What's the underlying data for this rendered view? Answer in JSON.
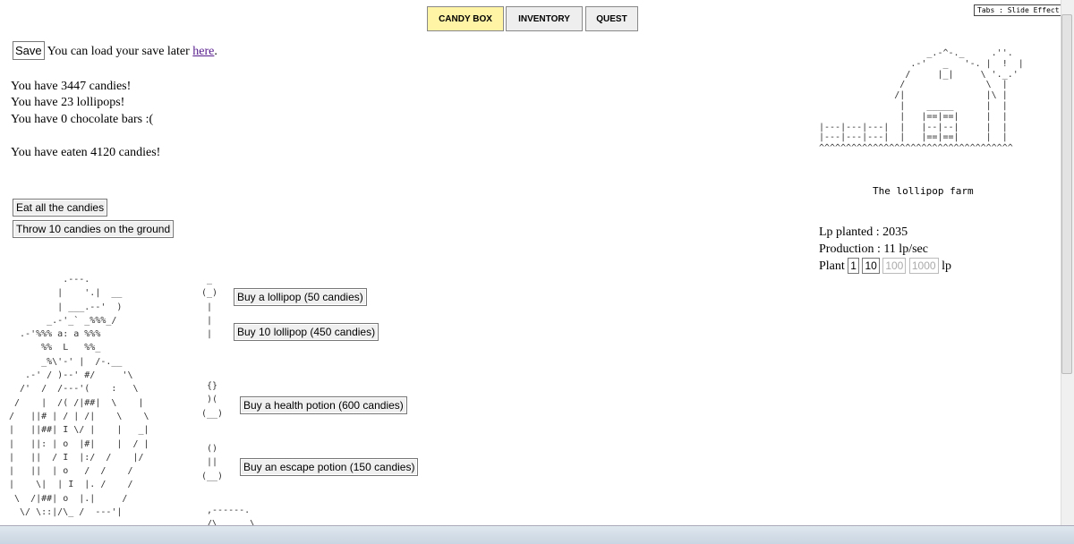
{
  "tabs": [
    {
      "label": "CANDY BOX",
      "active": true
    },
    {
      "label": "INVENTORY"
    },
    {
      "label": "QUEST"
    }
  ],
  "tabs_effect_button": "Tabs : Slide Effect",
  "save": {
    "button": "Save",
    "text": "You can load your save later",
    "link": "here",
    "after": "."
  },
  "status": {
    "candies": "You have 3447 candies!",
    "lollipops": "You have 23 lollipops!",
    "chocolate": "You have 0 chocolate bars :(",
    "eaten": "You have eaten 4120 candies!"
  },
  "actions": {
    "eat": "Eat all the candies",
    "throw": "Throw 10 candies on the ground"
  },
  "shop": {
    "lollipop": "Buy a lollipop (50 candies)",
    "lollipop10": "Buy 10 lollipop (450 candies)",
    "health": "Buy a health potion (600 candies)",
    "escape": "Buy an escape potion (150 candies)"
  },
  "farm": {
    "title": "The lollipop farm",
    "planted": "Lp planted : 2035",
    "production": "Production : 11 lp/sec",
    "plant_label": "Plant",
    "plant_options": [
      "1",
      "10",
      "100",
      "1000"
    ],
    "unit": "lp"
  },
  "colors": {
    "active_tab": "#fff3a6",
    "link": "#551a8b"
  }
}
